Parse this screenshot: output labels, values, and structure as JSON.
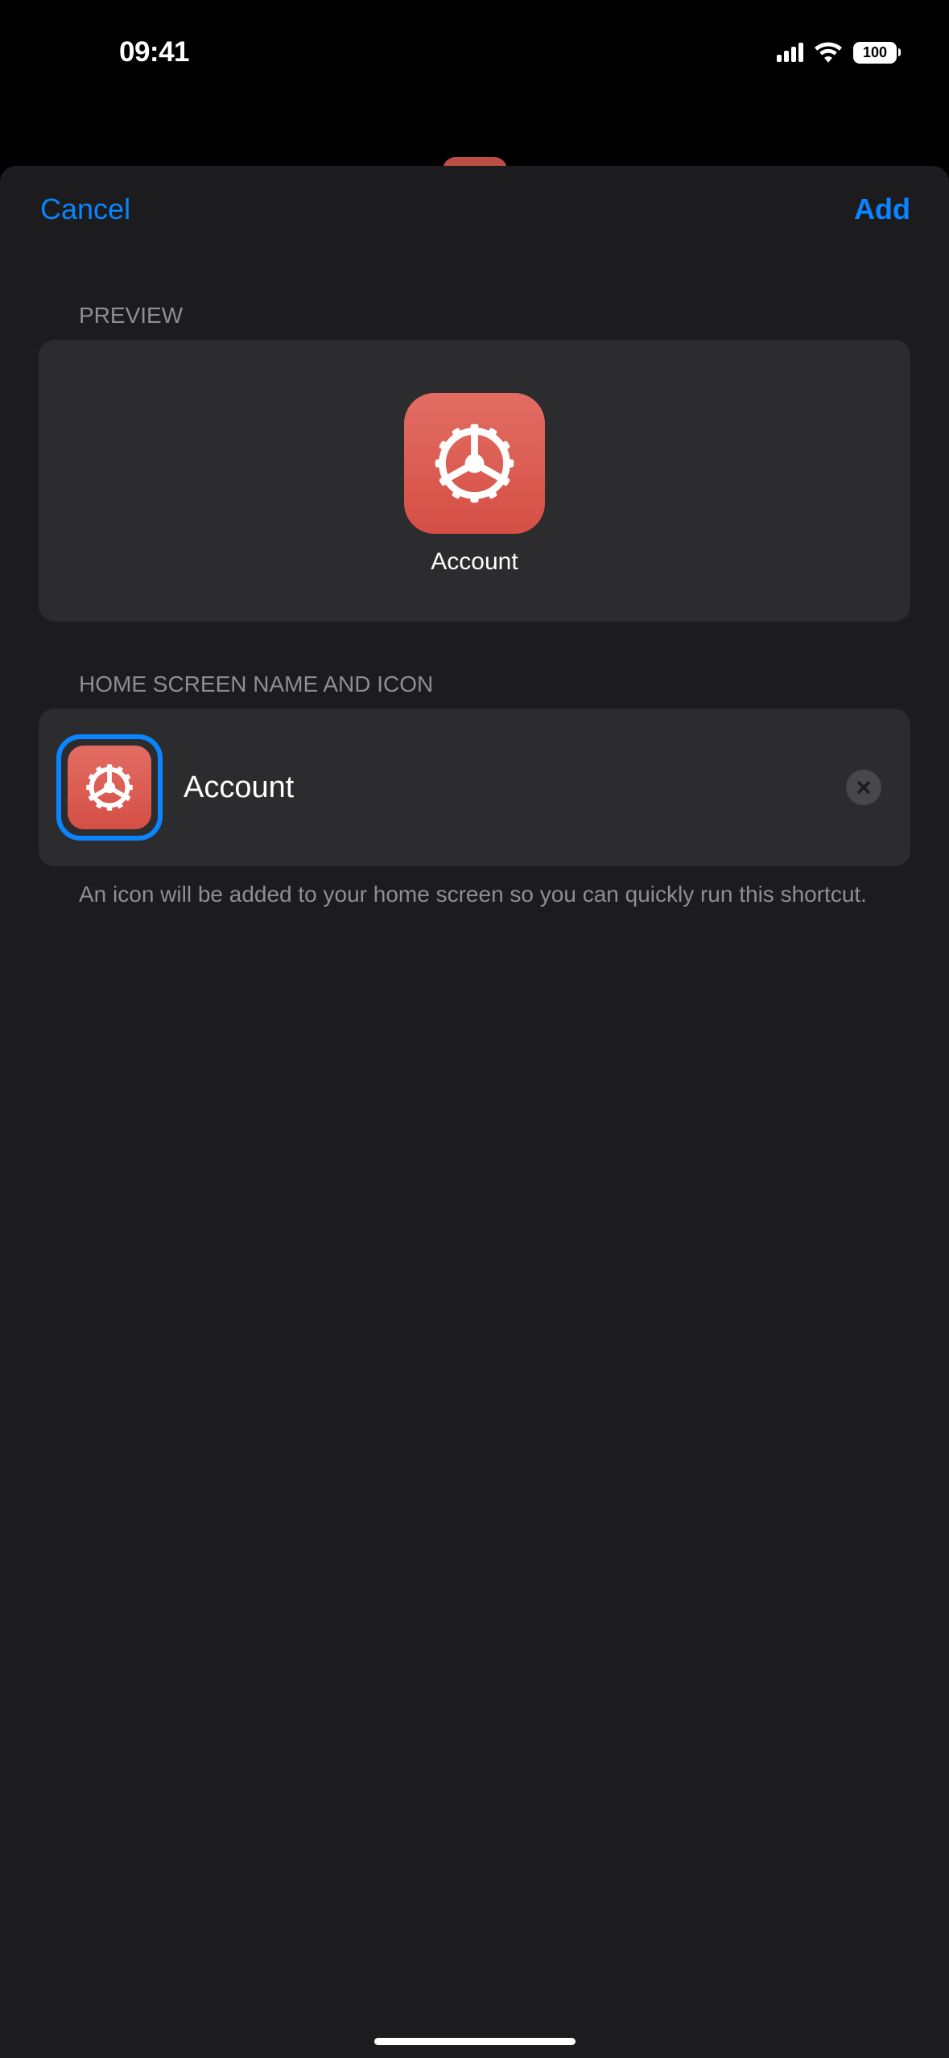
{
  "status": {
    "time": "09:41",
    "battery": "100"
  },
  "nav": {
    "cancel": "Cancel",
    "add": "Add"
  },
  "sections": {
    "preview_header": "Preview",
    "name_header": "Home Screen Name and Icon",
    "footer": "An icon will be added to your home screen so you can quickly run this shortcut."
  },
  "preview": {
    "label": "Account"
  },
  "form": {
    "name_value": "Account"
  },
  "colors": {
    "accent": "#0a84ff",
    "icon_bg_top": "#e36d63",
    "icon_bg_bottom": "#d44f45"
  }
}
